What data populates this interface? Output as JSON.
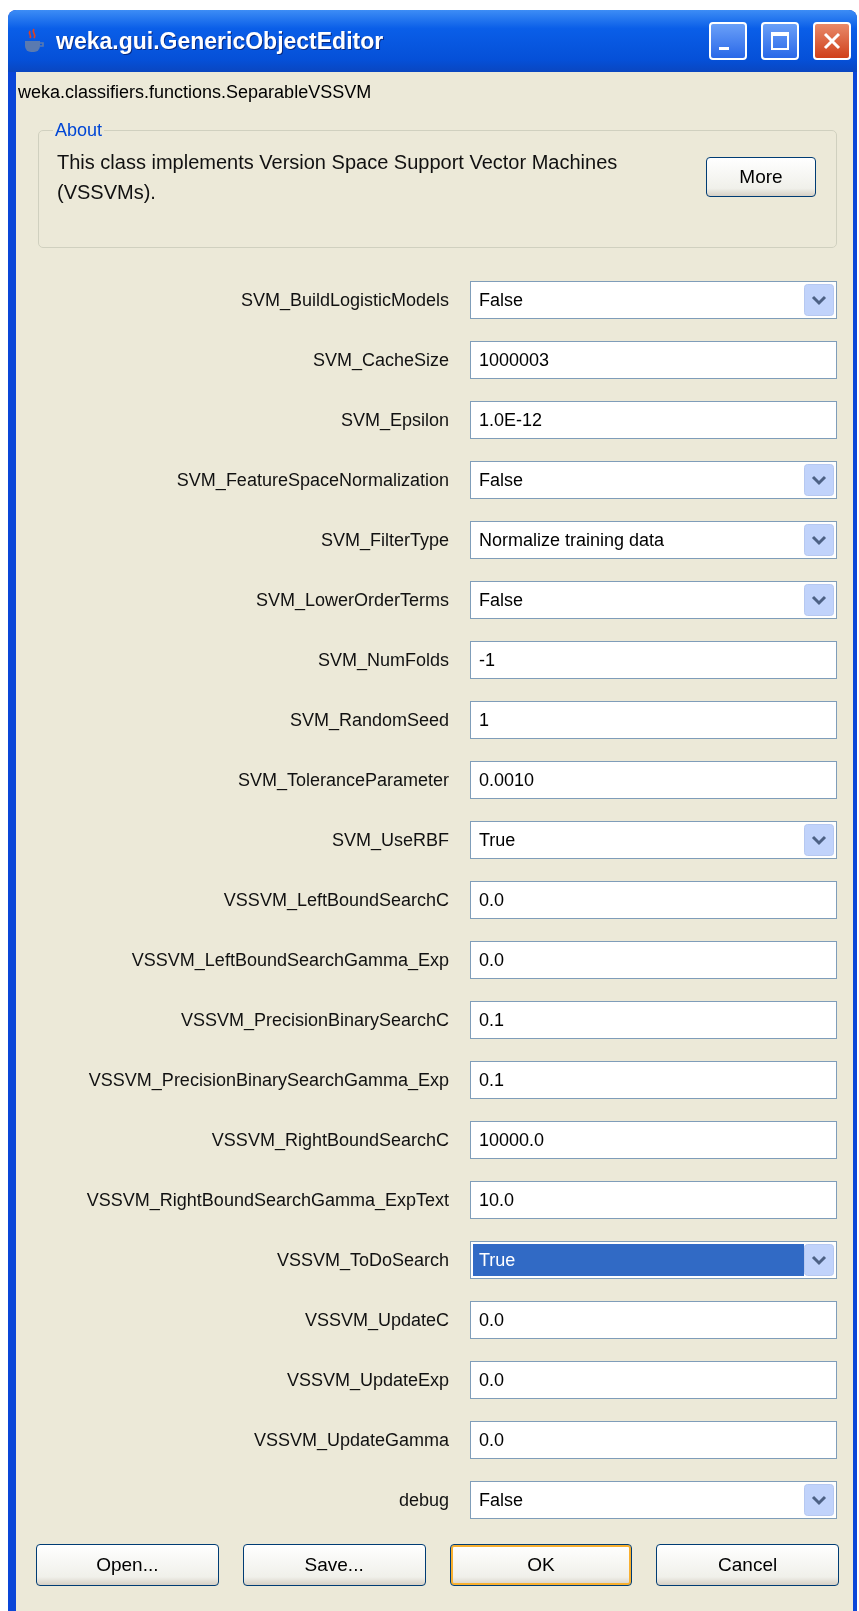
{
  "window": {
    "title": "weka.gui.GenericObjectEditor"
  },
  "class_name": "weka.classifiers.functions.SeparableVSSVM",
  "about": {
    "title": "About",
    "text": "This class implements Version Space Support Vector Machines (VSSVMs).",
    "button": "More"
  },
  "properties": [
    {
      "label": "SVM_BuildLogisticModels",
      "kind": "dropdown",
      "value": "False",
      "highlighted": false
    },
    {
      "label": "SVM_CacheSize",
      "kind": "text",
      "value": "1000003",
      "highlighted": false
    },
    {
      "label": "SVM_Epsilon",
      "kind": "text",
      "value": "1.0E-12",
      "highlighted": false
    },
    {
      "label": "SVM_FeatureSpaceNormalization",
      "kind": "dropdown",
      "value": "False",
      "highlighted": false
    },
    {
      "label": "SVM_FilterType",
      "kind": "dropdown",
      "value": "Normalize training data",
      "highlighted": false
    },
    {
      "label": "SVM_LowerOrderTerms",
      "kind": "dropdown",
      "value": "False",
      "highlighted": false
    },
    {
      "label": "SVM_NumFolds",
      "kind": "text",
      "value": "-1",
      "highlighted": false
    },
    {
      "label": "SVM_RandomSeed",
      "kind": "text",
      "value": "1",
      "highlighted": false
    },
    {
      "label": "SVM_ToleranceParameter",
      "kind": "text",
      "value": "0.0010",
      "highlighted": false
    },
    {
      "label": "SVM_UseRBF",
      "kind": "dropdown",
      "value": "True",
      "highlighted": false
    },
    {
      "label": "VSSVM_LeftBoundSearchC",
      "kind": "text",
      "value": "0.0",
      "highlighted": false
    },
    {
      "label": "VSSVM_LeftBoundSearchGamma_Exp",
      "kind": "text",
      "value": "0.0",
      "highlighted": false
    },
    {
      "label": "VSSVM_PrecisionBinarySearchC",
      "kind": "text",
      "value": "0.1",
      "highlighted": false
    },
    {
      "label": "VSSVM_PrecisionBinarySearchGamma_Exp",
      "kind": "text",
      "value": "0.1",
      "highlighted": false
    },
    {
      "label": "VSSVM_RightBoundSearchC",
      "kind": "text",
      "value": "10000.0",
      "highlighted": false
    },
    {
      "label": "VSSVM_RightBoundSearchGamma_ExpText",
      "kind": "text",
      "value": "10.0",
      "highlighted": false
    },
    {
      "label": "VSSVM_ToDoSearch",
      "kind": "dropdown",
      "value": "True",
      "highlighted": true
    },
    {
      "label": "VSSVM_UpdateC",
      "kind": "text",
      "value": "0.0",
      "highlighted": false
    },
    {
      "label": "VSSVM_UpdateExp",
      "kind": "text",
      "value": "0.0",
      "highlighted": false
    },
    {
      "label": "VSSVM_UpdateGamma",
      "kind": "text",
      "value": "0.0",
      "highlighted": false
    },
    {
      "label": "debug",
      "kind": "dropdown",
      "value": "False",
      "highlighted": false
    }
  ],
  "buttons": [
    {
      "label": "Open...",
      "default": false
    },
    {
      "label": "Save...",
      "default": false
    },
    {
      "label": "OK",
      "default": true
    },
    {
      "label": "Cancel",
      "default": false
    }
  ]
}
